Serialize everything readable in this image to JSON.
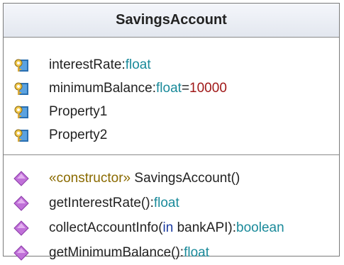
{
  "class": {
    "name": "SavingsAccount",
    "attributes": [
      {
        "name": "interestRate",
        "sep": ":",
        "type": "float",
        "default_sep": "",
        "default": ""
      },
      {
        "name": "minimumBalance",
        "sep": ":",
        "type": "float",
        "default_sep": "=",
        "default": "10000"
      },
      {
        "name": "Property1",
        "sep": "",
        "type": "",
        "default_sep": "",
        "default": ""
      },
      {
        "name": "Property2",
        "sep": "",
        "type": "",
        "default_sep": "",
        "default": ""
      }
    ],
    "operations": [
      {
        "stereotype": "«constructor»",
        "name": " SavingsAccount()",
        "param_kw": "",
        "param_rest": "",
        "sep": "",
        "type": ""
      },
      {
        "stereotype": "",
        "name": "getInterestRate()",
        "param_kw": "",
        "param_rest": "",
        "sep": ":",
        "type": "float"
      },
      {
        "stereotype": "",
        "name": "collectAccountInfo(",
        "param_kw": "in",
        "param_rest": " bankAPI)",
        "sep": ":",
        "type": "boolean"
      },
      {
        "stereotype": "",
        "name": "getMinimumBalance()",
        "param_kw": "",
        "param_rest": "",
        "sep": ":",
        "type": "float"
      }
    ]
  },
  "icons": {
    "attribute": "property-key-icon",
    "operation": "operation-diamond-icon"
  },
  "colors": {
    "type": "#1a8a9a",
    "default_value": "#a01818",
    "operation_icon": "#c070d8",
    "attribute_icon": "#2a6fb0"
  }
}
